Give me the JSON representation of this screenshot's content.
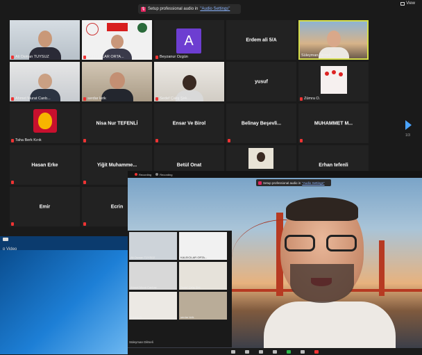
{
  "top_banner": {
    "text": "Setup professional audio in",
    "link": "\"Audio Settings\""
  },
  "view_label": "View",
  "tiles": [
    {
      "name": "Ali Osman TÜYSÜZ",
      "center": ""
    },
    {
      "name": "KALEICILAR ORTA...",
      "center": ""
    },
    {
      "name": "Beyzanur Özgün",
      "center": ""
    },
    {
      "name": "",
      "center": "Erdem ali 5/A"
    },
    {
      "name": "Süleyman Dilmeli",
      "center": ""
    },
    {
      "name": "Ahmet Murat Canb...",
      "center": ""
    },
    {
      "name": "serdar kirik",
      "center": ""
    },
    {
      "name": "Sedef Çalış Şirk...",
      "center": ""
    },
    {
      "name": "",
      "center": "yusuf"
    },
    {
      "name": "Zümra Ö.",
      "center": ""
    },
    {
      "name": "Taha Berk Kırık",
      "center": ""
    },
    {
      "name": "",
      "center": "Nisa Nur TEFENLİ"
    },
    {
      "name": "",
      "center": "Ensar Ve Birol"
    },
    {
      "name": "",
      "center": "Belinay  Beşevli..."
    },
    {
      "name": "",
      "center": "MUHAMMET M..."
    },
    {
      "name": "",
      "center": "Hasan Erke"
    },
    {
      "name": "",
      "center": "Yiğit  Muhamme..."
    },
    {
      "name": "",
      "center": "Betül Onat"
    },
    {
      "name": "",
      "center": ""
    },
    {
      "name": "",
      "center": "Erhan tefenli"
    },
    {
      "name": "",
      "center": "Emir"
    },
    {
      "name": "",
      "center": "Ecrin"
    }
  ],
  "avatar_letter": "A",
  "page_indicator": "1/3",
  "left_toolbar": {
    "video_label": "p Video"
  },
  "inset": {
    "recording": "Recording",
    "second_pill": "Recording",
    "banner_text": "Setup professional audio in",
    "banner_link": "\"Audio Settings\"",
    "gallery": [
      "Ali Osman TÜYSÜZ",
      "KALEICILAR ORTA...",
      "Ahmet Murat Canbaz",
      "Sedef Çalış Şirk",
      "Zümra Ö.",
      "serdar kirik"
    ],
    "gallery_footer": "Süleyman Dilmeli"
  },
  "colors": {
    "active_border": "#d5de4a",
    "accent": "#4aa3ff",
    "mute": "#e33"
  }
}
